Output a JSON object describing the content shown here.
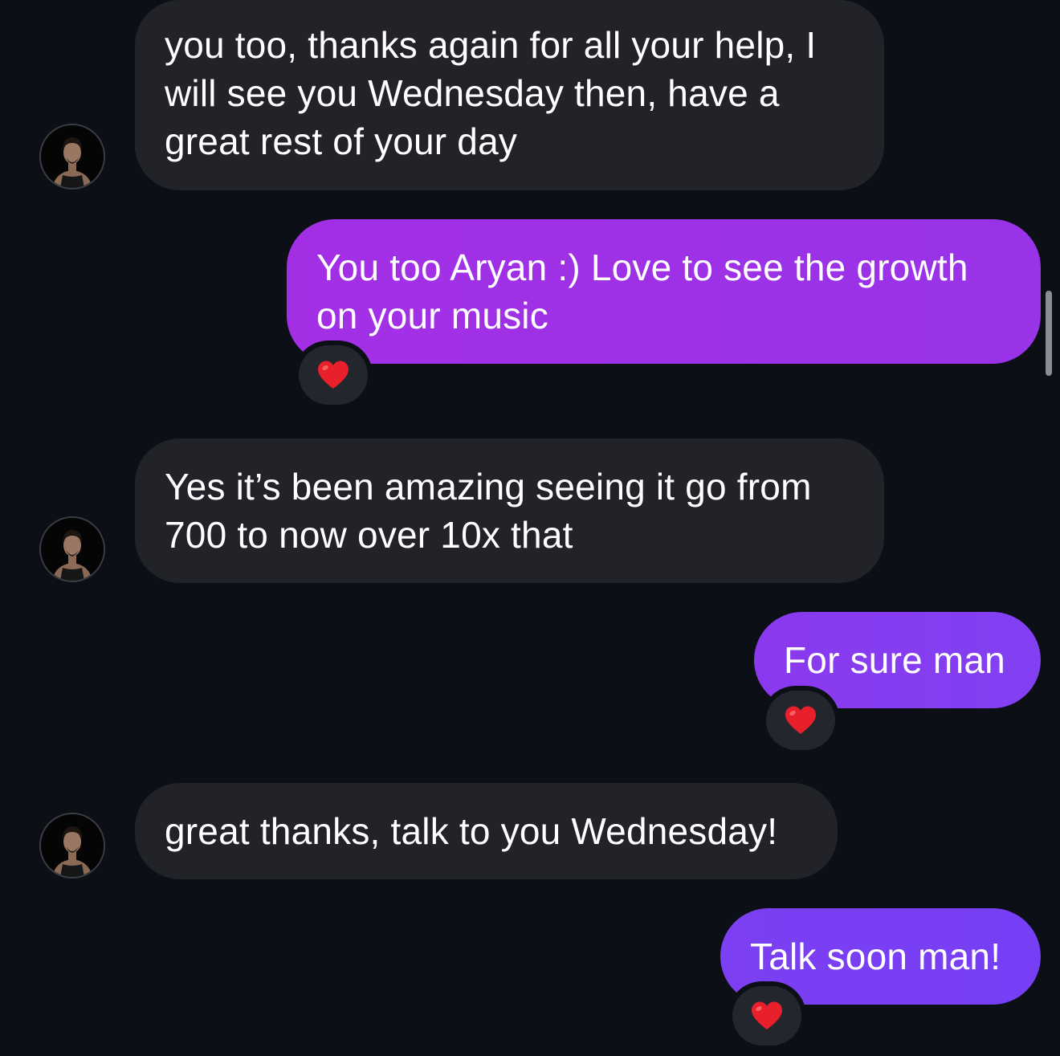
{
  "colors": {
    "background": "#0c0f15",
    "incoming_bubble": "#212329",
    "outgoing_bubble_gradient_start": "#9c2ee6",
    "outgoing_bubble_gradient_end": "#7a3ff5",
    "reaction_pill": "#23262d",
    "heart": "#e8202b"
  },
  "messages": [
    {
      "direction": "incoming",
      "lines": [
        "you too, thanks again for all your help, I",
        "will see you Wednesday then, have a",
        "great rest of your day"
      ],
      "avatar_icon": "profile-photo-avatar"
    },
    {
      "direction": "outgoing",
      "lines": [
        "You too Aryan :) Love to see the growth",
        "on your music"
      ],
      "reaction_icon": "heart-icon"
    },
    {
      "direction": "incoming",
      "lines": [
        "Yes it’s been amazing seeing it go from",
        "700 to now over 10x that"
      ],
      "avatar_icon": "profile-photo-avatar"
    },
    {
      "direction": "outgoing",
      "lines": [
        "For sure man"
      ],
      "reaction_icon": "heart-icon"
    },
    {
      "direction": "incoming",
      "lines": [
        "great thanks, talk to you Wednesday!"
      ],
      "avatar_icon": "profile-photo-avatar"
    },
    {
      "direction": "outgoing",
      "lines": [
        "Talk soon man!"
      ],
      "reaction_icon": "heart-icon"
    }
  ]
}
